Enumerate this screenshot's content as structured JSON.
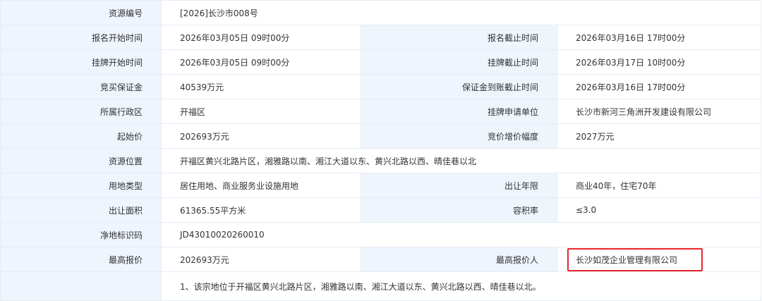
{
  "rows": [
    {
      "l1": "资源编号",
      "v1": "[2026]长沙市008号"
    },
    {
      "l1": "报名开始时间",
      "v1": "2026年03月05日 09时00分",
      "l2": "报名截止时间",
      "v2": "2026年03月16日 17时00分"
    },
    {
      "l1": "挂牌开始时间",
      "v1": "2026年03月05日 09时00分",
      "l2": "挂牌截止时间",
      "v2": "2026年03月17日 10时00分"
    },
    {
      "l1": "竞买保证金",
      "v1": "40539万元",
      "l2": "保证金到账截止时间",
      "v2": "2026年03月16日 17时00分"
    },
    {
      "l1": "所属行政区",
      "v1": "开福区",
      "l2": "挂牌申请单位",
      "v2": "长沙市新河三角洲开发建设有限公司"
    },
    {
      "l1": "起始价",
      "v1": "202693万元",
      "l2": "竞价增价幅度",
      "v2": "2027万元"
    },
    {
      "l1": "资源位置",
      "v1": "开福区黄兴北路片区，湘雅路以南、湘江大道以东、黄兴北路以西、晴佳巷以北"
    },
    {
      "l1": "用地类型",
      "v1": "居住用地、商业服务业设施用地",
      "l2": "出让年限",
      "v2": "商业40年，住宅70年"
    },
    {
      "l1": "出让面积",
      "v1": "61365.55平方米",
      "l2": "容积率",
      "v2": "≤3.0"
    },
    {
      "l1": "净地标识码",
      "v1": "JD43010020260010"
    },
    {
      "l1": "最高报价",
      "v1": "202693万元",
      "l2": "最高报价人",
      "v2": "长沙如茂企业管理有限公司"
    },
    {
      "l1": "",
      "v1": "1、该宗地位于开福区黄兴北路片区，湘雅路以南、湘江大道以东、黄兴北路以西、晴佳巷以北。"
    }
  ],
  "highlight_color": "#e8262b",
  "label_bg": "#eef5fc"
}
